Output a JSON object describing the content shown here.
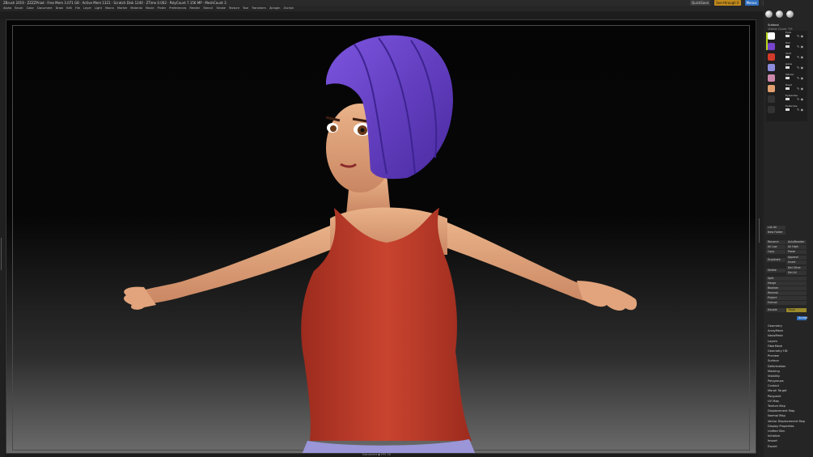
{
  "app": {
    "title": "ZBrush 2019 · ZZZZPriad · Free Mem 3.071 GB · Active Mem 1321 · Scratch Disk 1240 · ZTime 0.002 · PolyCount 7.156 MP · MeshCount 3",
    "quicksave_label": "QuickSave",
    "see_through_label": "See-through 0",
    "menus_label": "Menus",
    "script_label": "DefaultZScript"
  },
  "menubar": [
    "Alpha",
    "Brush",
    "Color",
    "Document",
    "Draw",
    "Edit",
    "File",
    "Layer",
    "Light",
    "Macro",
    "Marker",
    "Material",
    "Movie",
    "Picker",
    "Preferences",
    "Render",
    "Stencil",
    "Stroke",
    "Texture",
    "Tool",
    "Transform",
    "Zplugin",
    "Zscript"
  ],
  "viewport": {
    "status": "Document ◆ FPS 30"
  },
  "panel": {
    "subtool_title": "Subtool",
    "visible_count": "Visible Count 7/9",
    "brush_labels": [
      "ZModeler",
      "Standard"
    ],
    "subtools": [
      {
        "name": "Eyes",
        "color": "#ffffff"
      },
      {
        "name": "Hair",
        "color": "#7744cc"
      },
      {
        "name": "Shirt",
        "color": "#d23a2a"
      },
      {
        "name": "Jeans",
        "color": "#8c8cdc"
      },
      {
        "name": "Pillows",
        "color": "#cc88aa"
      },
      {
        "name": "Head",
        "color": "#e0a070"
      },
      {
        "name": "Eyelashes",
        "color": "#333333"
      },
      {
        "name": "Eyebrows",
        "color": "#333333"
      }
    ],
    "buttons": {
      "list_all": "List All",
      "new_folder": "New Folder",
      "rename": "Rename",
      "auto_reorder": "AutoReorder",
      "all_low": "All Low",
      "all_high": "All High",
      "copy": "Copy",
      "paste": "Paste",
      "duplicate": "Duplicate",
      "append": "Append",
      "insert": "Insert",
      "delete": "Delete",
      "del_other": "Del Other",
      "del_all": "Del All",
      "split": "Split",
      "merge": "Merge",
      "boolean": "Boolean",
      "remesh": "Remesh",
      "project": "Project",
      "extract": "Extract",
      "double": "Double",
      "thick": "Thick",
      "accept": "Accept"
    },
    "menu": [
      "Geometry",
      "ArrayMesh",
      "NanoMesh",
      "Layers",
      "FiberMesh",
      "Geometry HD",
      "Preview",
      "Surface",
      "Deformation",
      "Masking",
      "Visibility",
      "Polygroups",
      "Contact",
      "Morph Target",
      "Polypaint",
      "UV Map",
      "Texture Map",
      "Displacement Map",
      "Normal Map",
      "Vector Displacement Map",
      "Display Properties",
      "Unified Skin",
      "Initialize",
      "Import",
      "Export"
    ]
  },
  "colors": {
    "hair": "#6a3fc9",
    "shirt": "#c23c2c",
    "skin": "#e8a87c",
    "jeans": "#9a96d8",
    "accent": "#b8d61c"
  }
}
